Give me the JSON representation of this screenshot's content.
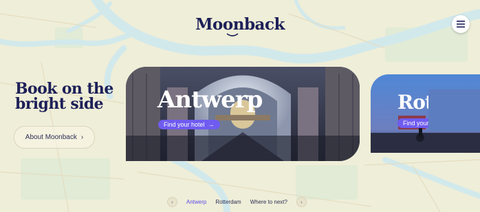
{
  "brand": {
    "name": "Moonback"
  },
  "hero": {
    "title_line1": "Book on the",
    "title_line2": "bright side",
    "about_button": "About Moonback",
    "about_chevron": "›"
  },
  "cards": [
    {
      "city": "Antwerp",
      "cta": "Find your hotel",
      "cta_icon": "arrow-right-icon",
      "cta_arrow": "→"
    },
    {
      "city": "Rotterdam",
      "city_visible": "Rott",
      "cta": "Find your hotel",
      "cta_visible": "Find your"
    }
  ],
  "pager": {
    "prev_symbol": "‹",
    "next_symbol": "›",
    "links": [
      "Antwerp",
      "Rotterdam",
      "Where to next?"
    ],
    "active_index": 0
  },
  "icons": {
    "menu": "hamburger-menu-icon",
    "prev": "chevron-left-icon",
    "next": "chevron-right-icon"
  },
  "colors": {
    "navy": "#1d2058",
    "accent": "#6f5cf0",
    "map_bg": "#f1ecd4",
    "water": "#d2e9ec"
  }
}
